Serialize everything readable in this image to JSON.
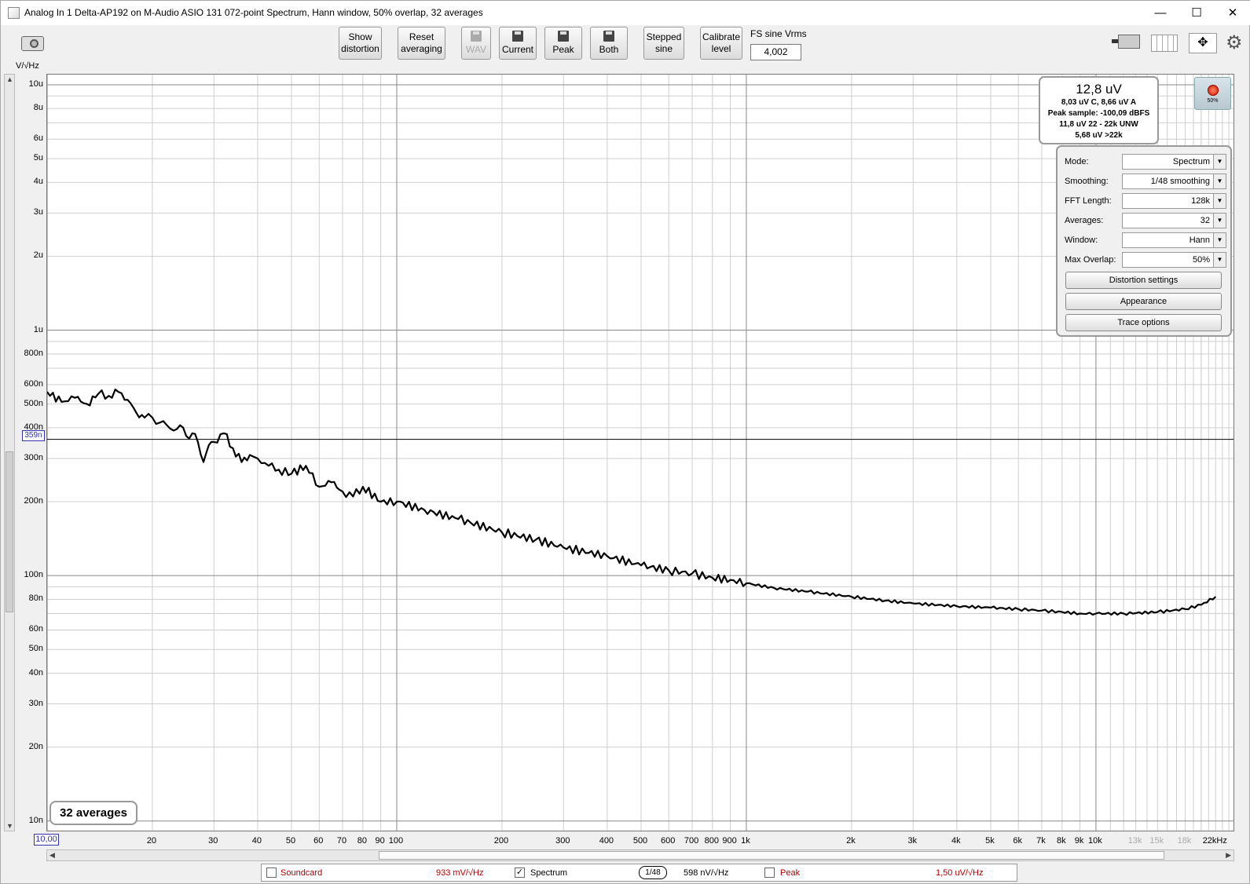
{
  "window": {
    "title": "Analog In 1 Delta-AP192 on M-Audio ASIO 131 072-point Spectrum, Hann window, 50% overlap, 32 averages",
    "minimize": "—",
    "maximize": "☐",
    "close": "✕"
  },
  "toolbar": {
    "show_distortion": "Show\ndistortion",
    "reset_averaging": "Reset\naveraging",
    "wav": "WAV",
    "current": "Current",
    "peak": "Peak",
    "both": "Both",
    "stepped_sine": "Stepped\nsine",
    "calibrate_level": "Calibrate\nlevel",
    "fs_label": "FS sine Vrms",
    "fs_value": "4,002"
  },
  "graph": {
    "y_unit": "V/√Hz",
    "y_marker": "359n",
    "x_marker": "10,00",
    "y_ticks": [
      "10u",
      "8u",
      "6u",
      "5u",
      "4u",
      "3u",
      "2u",
      "1u",
      "800n",
      "600n",
      "500n",
      "400n",
      "300n",
      "200n",
      "100n",
      "80n",
      "60n",
      "50n",
      "40n",
      "30n",
      "20n",
      "10n"
    ],
    "x_ticks": [
      "20",
      "30",
      "40",
      "50",
      "60",
      "70",
      "80",
      "90",
      "100",
      "200",
      "300",
      "400",
      "500",
      "600",
      "700",
      "800",
      "900",
      "1k",
      "2k",
      "3k",
      "4k",
      "5k",
      "6k",
      "7k",
      "8k",
      "9k",
      "10k",
      "13k",
      "15k",
      "18k",
      "22kHz"
    ],
    "trace_color": "#000000"
  },
  "readout": {
    "main": "12,8 uV",
    "line1": "8,03 uV C, 8,66 uV A",
    "line2": "Peak sample: -100,09 dBFS",
    "line3": "11,8 uV 22 - 22k UNW",
    "line4": "5,68 uV >22k",
    "record_pct": "50%"
  },
  "controls": {
    "mode_label": "Mode:",
    "mode_value": "Spectrum",
    "smoothing_label": "Smoothing:",
    "smoothing_value": "1/48 smoothing",
    "fft_label": "FFT Length:",
    "fft_value": "128k",
    "averages_label": "Averages:",
    "averages_value": "32",
    "window_label": "Window:",
    "window_value": "Hann",
    "overlap_label": "Max Overlap:",
    "overlap_value": "50%",
    "distortion_settings": "Distortion settings",
    "appearance": "Appearance",
    "trace_options": "Trace options"
  },
  "averages_badge": "32 averages",
  "legend": {
    "soundcard_label": "Soundcard",
    "soundcard_value": "933 mV/√Hz",
    "spectrum_label": "Spectrum",
    "spectrum_check": "✓",
    "smoothing_badge": "1/48",
    "spectrum_value": "598 nV/√Hz",
    "peak_label": "Peak",
    "peak_value": "1,50 uV/√Hz"
  },
  "chart_data": {
    "type": "line",
    "xlabel": "",
    "ylabel": "V/√Hz",
    "x_scale": "log",
    "y_scale": "log",
    "xlim": [
      10,
      25000
    ],
    "ylim": [
      9e-09,
      1.1e-05
    ],
    "grid": true,
    "series": [
      {
        "x": [
          10,
          11,
          12,
          13,
          14,
          15,
          16,
          17,
          18,
          19,
          20,
          21,
          22,
          23,
          24,
          25,
          26,
          27,
          28,
          29,
          30,
          32,
          34,
          36,
          38,
          40,
          43,
          46,
          50,
          55,
          60,
          65,
          70,
          75,
          80,
          90,
          100,
          120,
          150,
          200,
          250,
          300,
          400,
          500,
          600,
          700,
          800,
          900,
          1000,
          1200,
          1500,
          2000,
          2500,
          3000,
          4000,
          5000,
          6000,
          7000,
          8000,
          9000,
          10000,
          12000,
          15000,
          18000,
          20000,
          22000
        ],
        "y": [
          5.6e-07,
          5.1e-07,
          5.3e-07,
          5e-07,
          5.5e-07,
          5.4e-07,
          5.6e-07,
          5.2e-07,
          4.6e-07,
          4.4e-07,
          4.4e-07,
          4.2e-07,
          4.1e-07,
          3.9e-07,
          4.1e-07,
          3.7e-07,
          3.8e-07,
          3.5e-07,
          2.9e-07,
          3.4e-07,
          3.5e-07,
          3.8e-07,
          3.3e-07,
          2.9e-07,
          3.1e-07,
          3e-07,
          2.8e-07,
          2.7e-07,
          2.6e-07,
          2.8e-07,
          2.3e-07,
          2.4e-07,
          2.2e-07,
          2.1e-07,
          2.3e-07,
          2e-07,
          2e-07,
          1.85e-07,
          1.7e-07,
          1.5e-07,
          1.4e-07,
          1.3e-07,
          1.2e-07,
          1.1e-07,
          1.05e-07,
          1.02e-07,
          9.8e-08,
          9.6e-08,
          9.3e-08,
          8.9e-08,
          8.6e-08,
          8.2e-08,
          7.9e-08,
          7.7e-08,
          7.5e-08,
          7.4e-08,
          7.3e-08,
          7.2e-08,
          7.1e-08,
          7e-08,
          7e-08,
          7e-08,
          7.1e-08,
          7.3e-08,
          7.6e-08,
          8.2e-08
        ]
      }
    ]
  }
}
